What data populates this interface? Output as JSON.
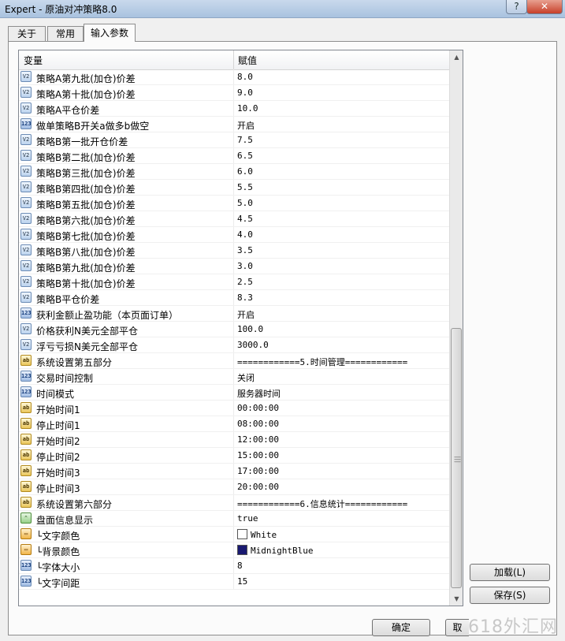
{
  "window": {
    "title": "Expert - 原油对冲策略8.0",
    "help": "?",
    "close": "✕"
  },
  "tabs": [
    {
      "label": "关于"
    },
    {
      "label": "常用"
    },
    {
      "label": "输入参数"
    }
  ],
  "grid": {
    "header": {
      "variable": "变量",
      "value": "赋值"
    },
    "rows": [
      {
        "icon": "dbl",
        "name": "策略A第九批(加仓)价差",
        "value": "8.0"
      },
      {
        "icon": "dbl",
        "name": "策略A第十批(加仓)价差",
        "value": "9.0"
      },
      {
        "icon": "dbl",
        "name": "策略A平仓价差",
        "value": "10.0"
      },
      {
        "icon": "int",
        "name": "做单策略B开关a做多b做空",
        "value": "开启"
      },
      {
        "icon": "dbl",
        "name": "策略B第一批开仓价差",
        "value": "7.5"
      },
      {
        "icon": "dbl",
        "name": "策略B第二批(加仓)价差",
        "value": "6.5"
      },
      {
        "icon": "dbl",
        "name": "策略B第三批(加仓)价差",
        "value": "6.0"
      },
      {
        "icon": "dbl",
        "name": "策略B第四批(加仓)价差",
        "value": "5.5"
      },
      {
        "icon": "dbl",
        "name": "策略B第五批(加仓)价差",
        "value": "5.0"
      },
      {
        "icon": "dbl",
        "name": "策略B第六批(加仓)价差",
        "value": "4.5"
      },
      {
        "icon": "dbl",
        "name": "策略B第七批(加仓)价差",
        "value": "4.0"
      },
      {
        "icon": "dbl",
        "name": "策略B第八批(加仓)价差",
        "value": "3.5"
      },
      {
        "icon": "dbl",
        "name": "策略B第九批(加仓)价差",
        "value": "3.0"
      },
      {
        "icon": "dbl",
        "name": "策略B第十批(加仓)价差",
        "value": "2.5"
      },
      {
        "icon": "dbl",
        "name": "策略B平仓价差",
        "value": "8.3"
      },
      {
        "icon": "int",
        "name": "获利金额止盈功能（本页面订单）",
        "value": "开启"
      },
      {
        "icon": "dbl",
        "name": "价格获利N美元全部平仓",
        "value": "100.0"
      },
      {
        "icon": "dbl",
        "name": "浮亏亏损N美元全部平仓",
        "value": "3000.0"
      },
      {
        "icon": "str",
        "name": "系统设置第五部分",
        "value": "============5.时间管理============"
      },
      {
        "icon": "int",
        "name": "交易时间控制",
        "value": "关闭"
      },
      {
        "icon": "int",
        "name": "时间模式",
        "value": "服务器时间"
      },
      {
        "icon": "str",
        "name": "开始时间1",
        "value": "00:00:00"
      },
      {
        "icon": "str",
        "name": "停止时间1",
        "value": "08:00:00"
      },
      {
        "icon": "str",
        "name": "开始时间2",
        "value": "12:00:00"
      },
      {
        "icon": "str",
        "name": "停止时间2",
        "value": "15:00:00"
      },
      {
        "icon": "str",
        "name": "开始时间3",
        "value": "17:00:00"
      },
      {
        "icon": "str",
        "name": "停止时间3",
        "value": "20:00:00"
      },
      {
        "icon": "str",
        "name": "系统设置第六部分",
        "value": "============6.信息统计============"
      },
      {
        "icon": "bool",
        "name": "盘面信息显示",
        "value": "true"
      },
      {
        "icon": "clr",
        "name": "└文字颜色",
        "value": "White",
        "swatch": "#ffffff"
      },
      {
        "icon": "clr",
        "name": "└背景颜色",
        "value": "MidnightBlue",
        "swatch": "#191970"
      },
      {
        "icon": "int",
        "name": "└字体大小",
        "value": "8"
      },
      {
        "icon": "int",
        "name": "└文字间距",
        "value": "15"
      }
    ]
  },
  "icon_text": {
    "dbl": "V2",
    "int": "123",
    "str": "ab",
    "bool": "⌃",
    "clr": "▭"
  },
  "buttons": {
    "load": "加载(L)",
    "save": "保存(S)",
    "ok": "确定",
    "cancel": "取"
  },
  "watermark": "618外汇网"
}
